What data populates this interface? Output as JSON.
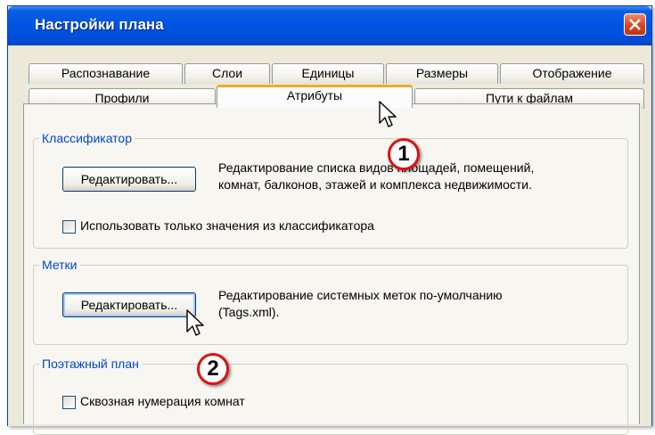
{
  "window": {
    "title": "Настройки плана"
  },
  "tabs": {
    "row1": [
      "Распознавание",
      "Слои",
      "Единицы",
      "Размеры",
      "Отображение"
    ],
    "row2": [
      "Профили",
      "Атрибуты",
      "Пути к файлам"
    ],
    "active": "Атрибуты"
  },
  "classifier": {
    "legend": "Классификатор",
    "edit_button": "Редактировать...",
    "description_line1": "Редактирование списка видов площадей, помещений,",
    "description_line2": "комнат, балконов, этажей и комплекса недвижимости.",
    "only_classifier_checkbox": {
      "label": "Использовать только значения из классификатора",
      "checked": false
    }
  },
  "tags": {
    "legend": "Метки",
    "edit_button": "Редактировать...",
    "description_line1": "Редактирование системных меток по-умолчанию",
    "description_line2": "(Tags.xml)."
  },
  "floor_plan": {
    "legend": "Поэтажный план",
    "through_numbering_checkbox": {
      "label": "Сквозная нумерация комнат",
      "checked": false
    }
  },
  "callouts": [
    "1",
    "2"
  ],
  "colors": {
    "title_bar": "#0054e3",
    "group_legend": "#0046d5",
    "active_tab_accent": "#f0a833",
    "callout_border": "#e01010",
    "close_button": "#d9441f"
  }
}
